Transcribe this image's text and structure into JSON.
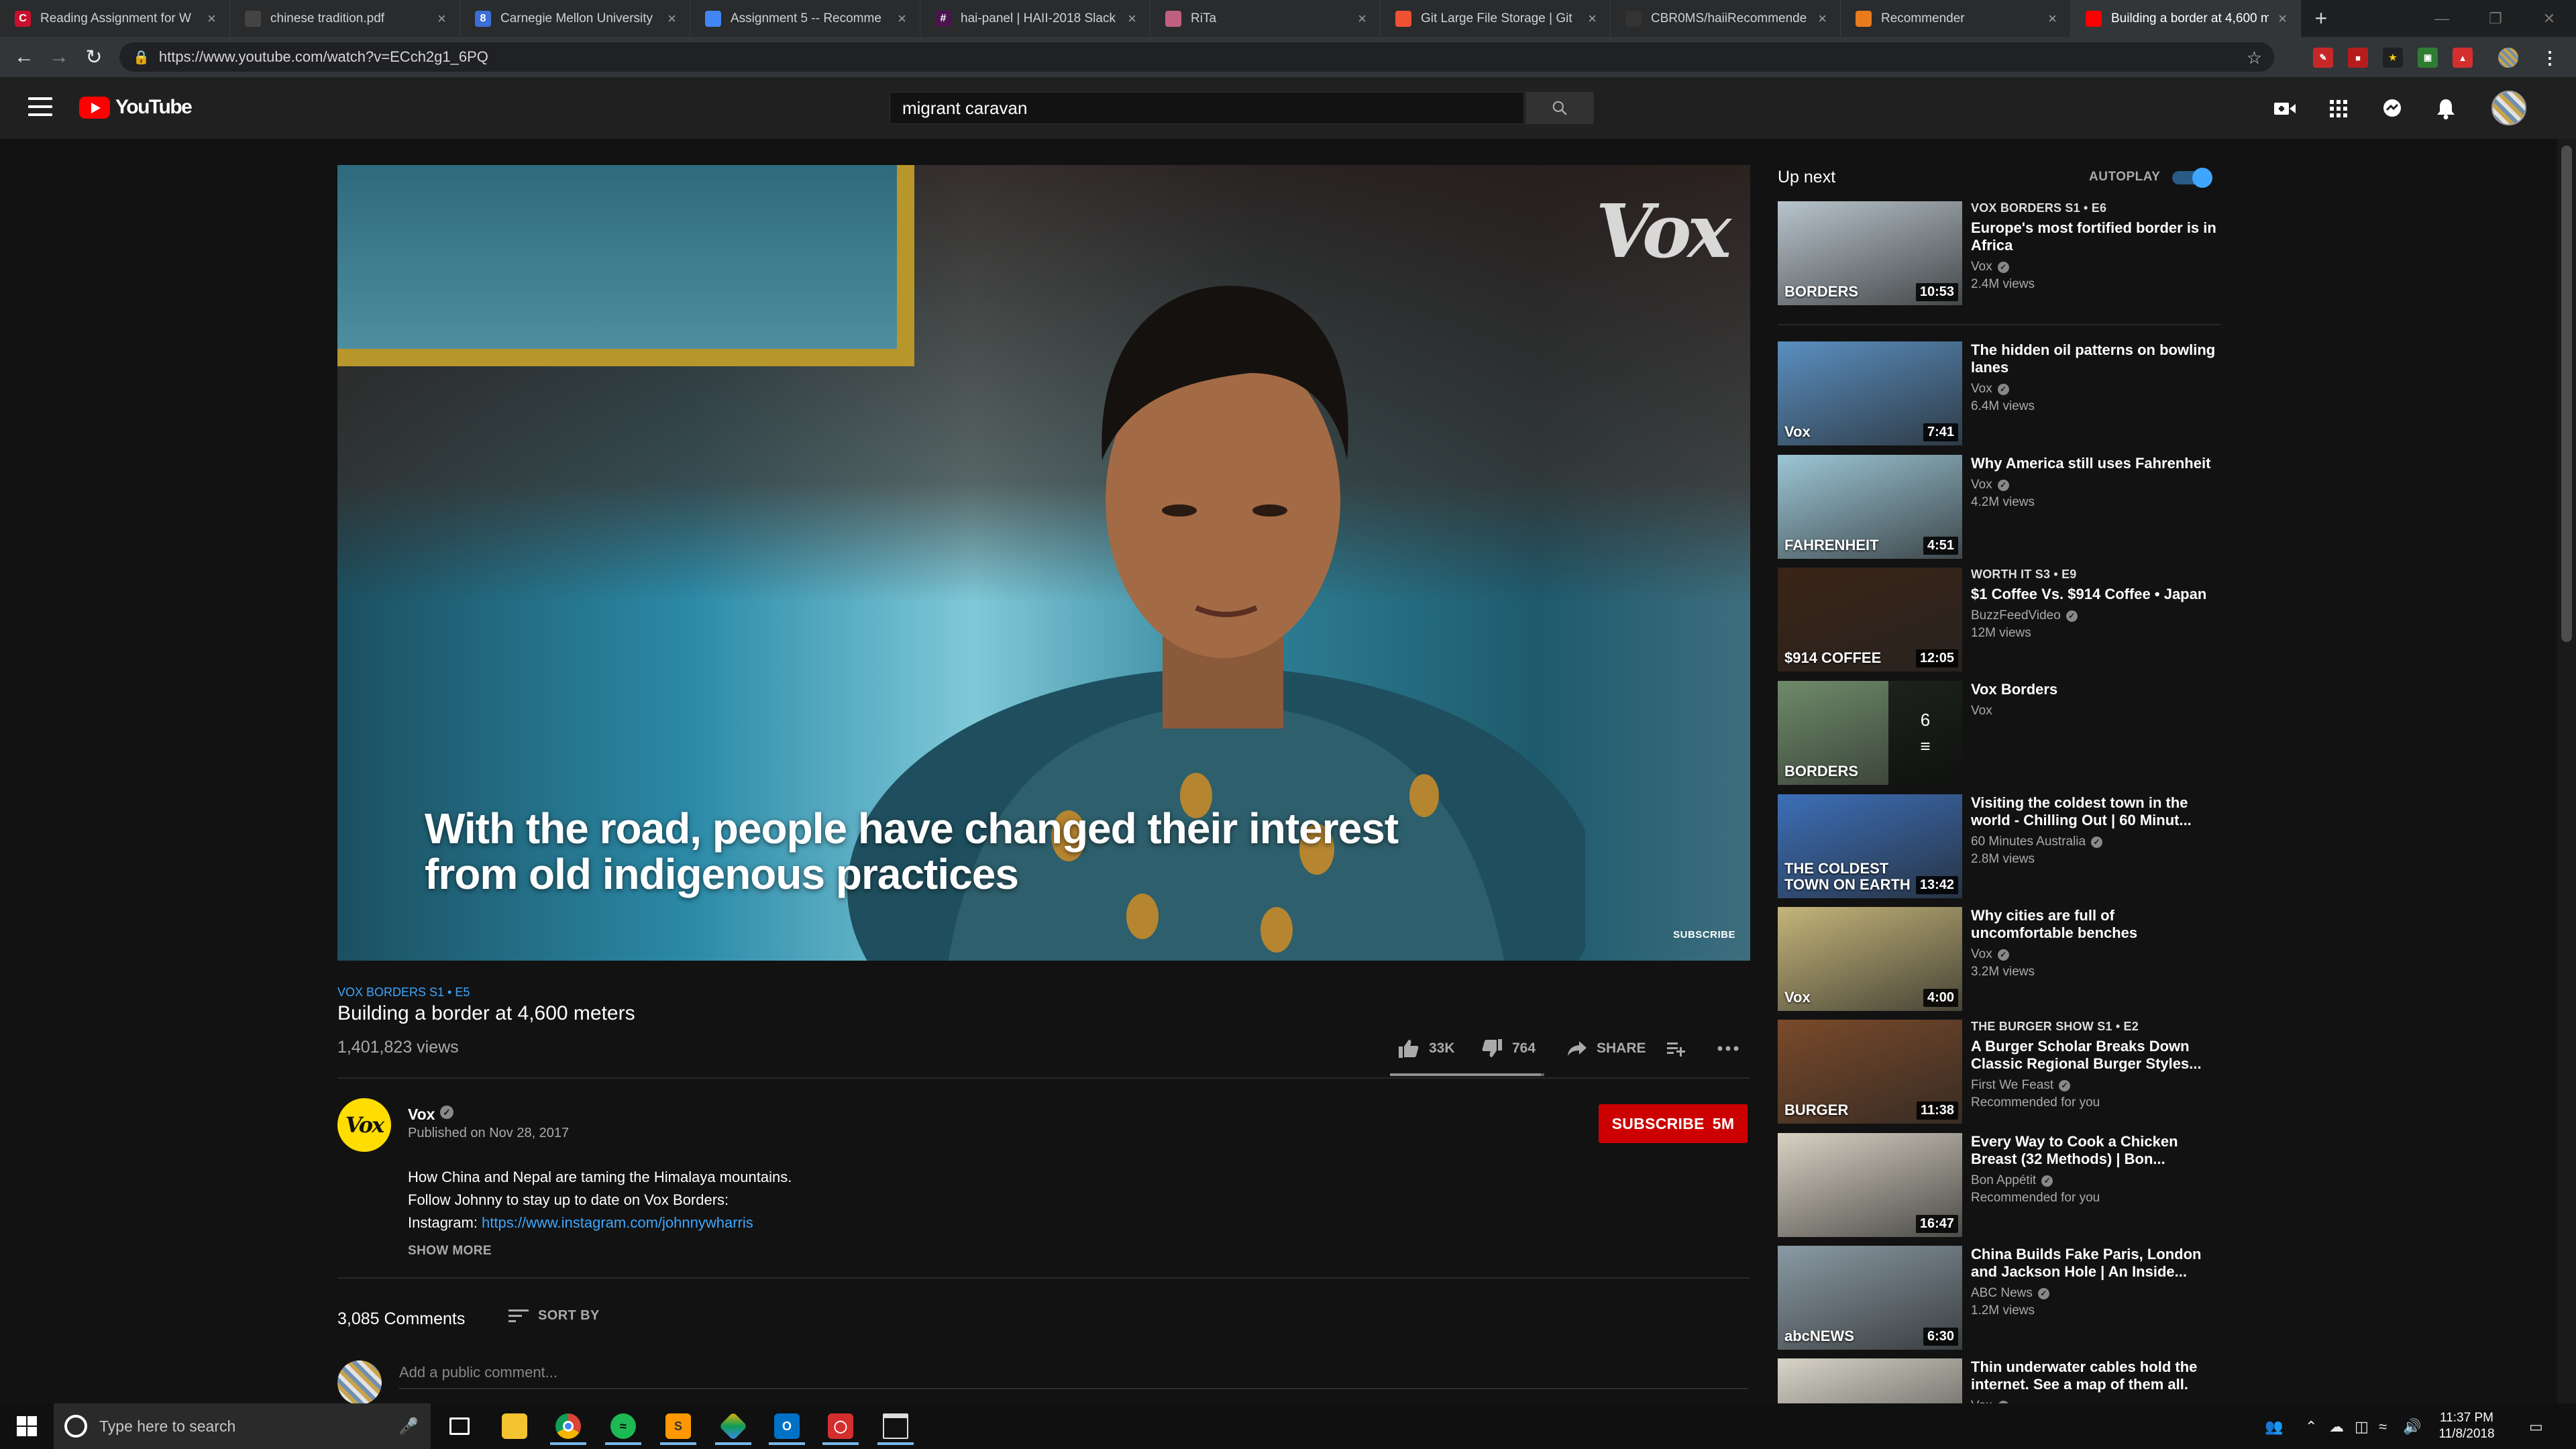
{
  "browser": {
    "tabs": [
      {
        "title": "Reading Assignment for W",
        "favicon_color": "#c8102e",
        "favicon_glyph": "C"
      },
      {
        "title": "chinese tradition.pdf",
        "favicon_color": "#444444",
        "favicon_glyph": ""
      },
      {
        "title": "Carnegie Mellon University",
        "favicon_color": "#3b6ed6",
        "favicon_glyph": "8"
      },
      {
        "title": "Assignment 5 -- Recomme",
        "favicon_color": "#4285f4",
        "favicon_glyph": ""
      },
      {
        "title": "hai-panel | HAII-2018 Slack",
        "favicon_color": "#4a154b",
        "favicon_glyph": "#"
      },
      {
        "title": "RiTa",
        "favicon_color": "#c06080",
        "favicon_glyph": ""
      },
      {
        "title": "Git Large File Storage | Git",
        "favicon_color": "#f05133",
        "favicon_glyph": ""
      },
      {
        "title": "CBR0MS/haiiRecommende",
        "favicon_color": "#333333",
        "favicon_glyph": ""
      },
      {
        "title": "Recommender",
        "favicon_color": "#e87b1e",
        "favicon_glyph": ""
      },
      {
        "title": "Building a border at 4,600 m",
        "favicon_color": "#ff0000",
        "favicon_glyph": "",
        "active": true
      }
    ],
    "url": "https://www.youtube.com/watch?v=ECch2g1_6PQ",
    "new_tab_glyph": "+"
  },
  "masthead": {
    "logo_text": "YouTube",
    "search_value": "migrant caravan",
    "search_placeholder": "Search"
  },
  "player": {
    "caption_line1": "With the road, people have changed their interest",
    "caption_line2": "from old indigenous practices",
    "watermark": "Vox",
    "subscribe_overlay": "SUBSCRIBE"
  },
  "video": {
    "series": "VOX BORDERS  S1 • E5",
    "title": "Building a border at 4,600 meters",
    "views": "1,401,823 views",
    "likes": "33K",
    "dislikes": "764",
    "share_label": "SHARE",
    "like_ratio": 0.977
  },
  "owner": {
    "avatar_text": "Vox",
    "name": "Vox",
    "published": "Published on Nov 28, 2017",
    "subscribe_label": "SUBSCRIBE",
    "subscriber_count": "5M"
  },
  "description": {
    "line1": "How China and Nepal are taming the Himalaya mountains.",
    "line2": "Follow Johnny to stay up to date on Vox Borders:",
    "line3_prefix": "Instagram: ",
    "line3_link": "https://www.instagram.com/johnnywharris",
    "show_more": "SHOW MORE"
  },
  "comments": {
    "count": "3,085 Comments",
    "sort_label": "SORT BY",
    "input_placeholder": "Add a public comment..."
  },
  "sidebar": {
    "up_next": "Up next",
    "autoplay_label": "AUTOPLAY",
    "autoplay_on": true,
    "items": [
      {
        "series": "VOX BORDERS  S1 • E6",
        "title": "Europe's most fortified border is in Africa",
        "channel": "Vox",
        "verified": true,
        "meta": "2.4M views",
        "duration": "10:53",
        "thumb_text": "BORDERS",
        "thumb_bg": "#b8c4cc"
      },
      {
        "series": "",
        "title": "The hidden oil patterns on bowling lanes",
        "channel": "Vox",
        "verified": true,
        "meta": "6.4M views",
        "duration": "7:41",
        "thumb_text": "Vox",
        "thumb_bg": "#5a8fc0"
      },
      {
        "series": "",
        "title": "Why America still uses Fahrenheit",
        "channel": "Vox",
        "verified": true,
        "meta": "4.2M views",
        "duration": "4:51",
        "thumb_text": "FAHRENHEIT",
        "thumb_bg": "#9cc6d6"
      },
      {
        "series": "WORTH IT  S3 • E9",
        "title": "$1 Coffee Vs. $914 Coffee • Japan",
        "channel": "BuzzFeedVideo",
        "verified": true,
        "meta": "12M views",
        "duration": "12:05",
        "thumb_text": "$914 COFFEE",
        "thumb_bg": "#3a2416"
      },
      {
        "series": "",
        "title": "Vox Borders",
        "channel": "Vox",
        "verified": false,
        "meta": "",
        "duration": "",
        "thumb_text": "BORDERS",
        "thumb_bg": "#6f8a6a",
        "playlist_count": "6"
      },
      {
        "series": "",
        "title": "Visiting the coldest town in the world - Chilling Out | 60 Minut...",
        "channel": "60 Minutes Australia",
        "verified": true,
        "meta": "2.8M views",
        "duration": "13:42",
        "thumb_text": "THE COLDEST TOWN ON EARTH",
        "thumb_bg": "#3c6fb8"
      },
      {
        "series": "",
        "title": "Why cities are full of uncomfortable benches",
        "channel": "Vox",
        "verified": true,
        "meta": "3.2M views",
        "duration": "4:00",
        "thumb_text": "Vox",
        "thumb_bg": "#c4b57a"
      },
      {
        "series": "THE BURGER SHOW  S1 • E2",
        "title": "A Burger Scholar Breaks Down Classic Regional Burger Styles...",
        "channel": "First We Feast",
        "verified": true,
        "meta": "Recommended for you",
        "duration": "11:38",
        "thumb_text": "BURGER",
        "thumb_bg": "#7a4a2a"
      },
      {
        "series": "",
        "title": "Every Way to Cook a Chicken Breast (32 Methods) | Bon...",
        "channel": "Bon Appétit",
        "verified": true,
        "meta": "Recommended for you",
        "duration": "16:47",
        "thumb_text": "",
        "thumb_bg": "#d8d2c4"
      },
      {
        "series": "",
        "title": "China Builds Fake Paris, London and Jackson Hole | An Inside...",
        "channel": "ABC News",
        "verified": true,
        "meta": "1.2M views",
        "duration": "6:30",
        "thumb_text": "abcNEWS",
        "thumb_bg": "#8a9aa4"
      },
      {
        "series": "",
        "title": "Thin underwater cables hold the internet. See a map of them all.",
        "channel": "Vox",
        "verified": true,
        "meta": "",
        "duration": "",
        "thumb_text": "",
        "thumb_bg": "#d8d4c8"
      }
    ]
  },
  "taskbar": {
    "search_placeholder": "Type here to search",
    "time": "11:37 PM",
    "date": "11/8/2018"
  },
  "colors": {
    "yt_red": "#ff0000",
    "subscribe_red": "#cc0000",
    "link_blue": "#3ea6ff",
    "page_bg": "#121212",
    "masthead_bg": "#202020"
  }
}
